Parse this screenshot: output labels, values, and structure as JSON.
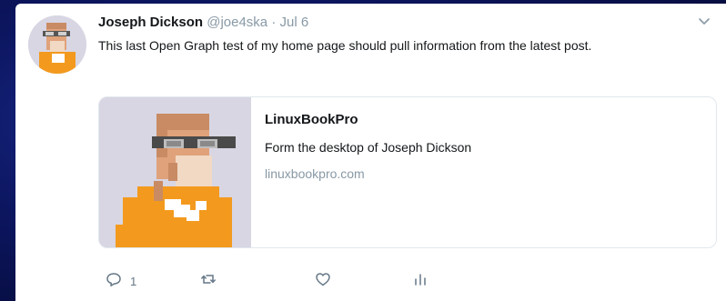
{
  "tweet": {
    "fullname": "Joseph Dickson",
    "handle": "@joe4ska",
    "separator": "·",
    "time": "Jul 6",
    "text": "This last Open Graph test of my home page should pull information from the latest post."
  },
  "card": {
    "title": "LinuxBookPro",
    "description": "Form the desktop of Joseph Dickson",
    "domain": "linuxbookpro.com"
  },
  "actions": {
    "reply_count": "1",
    "icons": [
      "reply-icon",
      "retweet-icon",
      "like-icon",
      "analytics-icon"
    ]
  },
  "colors": {
    "background": "#0c1660",
    "accent_orange": "#f39a1e",
    "muted_text": "#8899a6"
  }
}
